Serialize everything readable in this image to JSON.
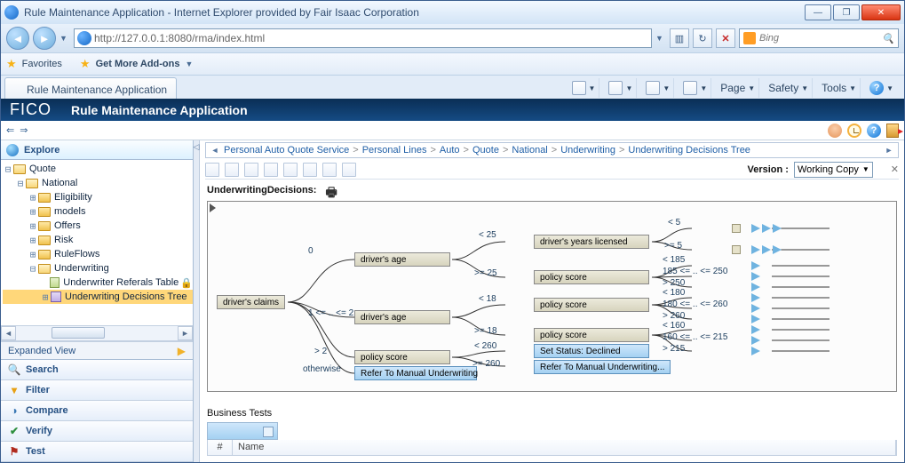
{
  "window": {
    "title": "Rule Maintenance Application - Internet Explorer provided by Fair Isaac Corporation"
  },
  "nav": {
    "url": "http://127.0.0.1:8080/rma/index.html",
    "search_placeholder": "Bing"
  },
  "favbar": {
    "favorites": "Favorites",
    "addons": "Get More Add-ons"
  },
  "tab": {
    "title": "Rule Maintenance Application"
  },
  "cmdbar": {
    "page": "Page",
    "safety": "Safety",
    "tools": "Tools"
  },
  "app": {
    "logo": "FICO",
    "title": "Rule Maintenance Application"
  },
  "sidebar": {
    "explore": "Explore",
    "expanded_view": "Expanded View",
    "accordion": {
      "search": "Search",
      "filter": "Filter",
      "compare": "Compare",
      "verify": "Verify",
      "test": "Test"
    },
    "tree": {
      "quote": "Quote",
      "national": "National",
      "eligibility": "Eligibility",
      "models": "models",
      "offers": "Offers",
      "risk": "Risk",
      "ruleflows": "RuleFlows",
      "underwriting": "Underwriting",
      "uw_referrals": "Underwriter Referals Table",
      "uw_tree": "Underwriting Decisions Tree"
    }
  },
  "breadcrumb": [
    "Personal Auto Quote Service",
    "Personal Lines",
    "Auto",
    "Quote",
    "National",
    "Underwriting",
    "Underwriting Decisions Tree"
  ],
  "toolbar": {
    "version_label": "Version :",
    "version_value": "Working Copy"
  },
  "section": {
    "title": "UnderwritingDecisions:"
  },
  "decision": {
    "root": "driver's claims",
    "age": "driver's age",
    "policy": "policy score",
    "years": "driver's years licensed",
    "refer": "Refer To Manual Underwriting",
    "declined": "Set Status: Declined",
    "refer_ell": "Refer To Manual Underwriting...",
    "edges": {
      "e0": "0",
      "e1": "1 <= .. <= 2",
      "e2": "> 2",
      "eoth": "otherwise",
      "lt25": "< 25",
      "ge25": ">= 25",
      "lt18": "< 18",
      "ge18": ">= 18",
      "lt260": "< 260",
      "ge260": ">= 260",
      "lt5": "< 5",
      "ge5": ">= 5",
      "lt185": "< 185",
      "r185": "185 <= .. <= 250",
      "gt250": "> 250",
      "lt180": "< 180",
      "r180": "180 <= .. <= 260",
      "gt260": "> 260",
      "lt160": "< 160",
      "r160": "160 <= .. <= 215",
      "gt215": "> 215"
    }
  },
  "business": {
    "title": "Business Tests",
    "col_num": "#",
    "col_name": "Name"
  }
}
